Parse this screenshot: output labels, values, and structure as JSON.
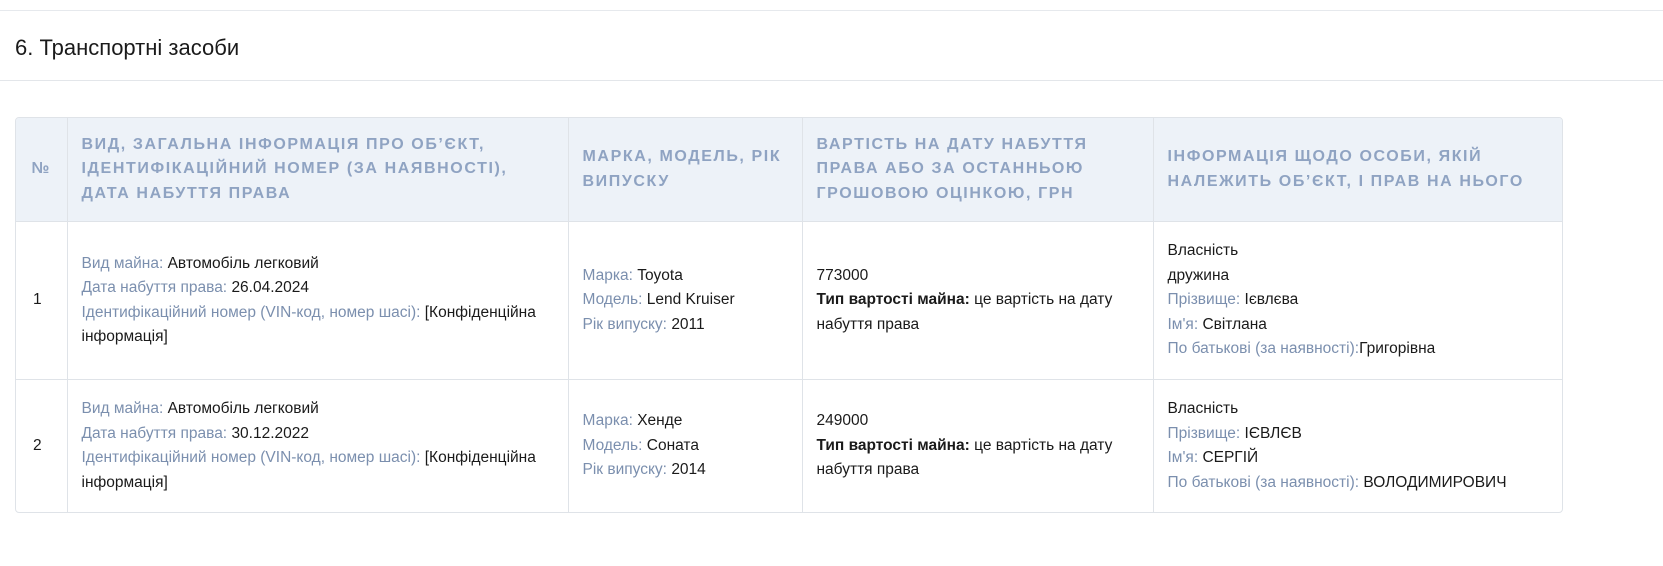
{
  "section": {
    "title": "6. Транспортні засоби"
  },
  "table": {
    "headers": [
      "№",
      "Вид, загальна інформація про об’єкт, ідентифікаційний номер (за наявності), дата набуття права",
      "Марка, модель, рік випуску",
      "Вартість на дату набуття права або за останньою грошовою оцінкою, грн",
      "Інформація щодо особи, якій належить об’єкт, і прав на нього"
    ],
    "rows": [
      {
        "num": "1",
        "type_label": "Вид майна:",
        "type_value": "Автомобіль легковий",
        "date_label": "Дата набуття права:",
        "date_value": "26.04.2024",
        "vin_label": "Ідентифікаційний номер (VIN-код, номер шасі):",
        "vin_value": "[Конфіденційна інформація]",
        "brand_label": "Марка:",
        "brand_value": "Toyota",
        "model_label": "Модель:",
        "model_value": "Lend Kruiser",
        "year_label": "Рік випуску:",
        "year_value": "2011",
        "cost_value": "773000",
        "cost_type_label": "Тип вартості майна:",
        "cost_type_value": "це вартість на дату набуття права",
        "owner_right": "Власність",
        "owner_relation": "дружина",
        "surname_label": "Прізвище:",
        "surname_value": "Ієвлєва",
        "name_label": "Ім'я:",
        "name_value": "Світлана",
        "patronymic_label": "По батькові (за наявності):",
        "patronymic_value": "Григорівна"
      },
      {
        "num": "2",
        "type_label": "Вид майна:",
        "type_value": "Автомобіль легковий",
        "date_label": "Дата набуття права:",
        "date_value": "30.12.2022",
        "vin_label": "Ідентифікаційний номер (VIN-код, номер шасі):",
        "vin_value": "[Конфіденційна інформація]",
        "brand_label": "Марка:",
        "brand_value": "Хенде",
        "model_label": "Модель:",
        "model_value": "Соната",
        "year_label": "Рік випуску:",
        "year_value": "2014",
        "cost_value": "249000",
        "cost_type_label": "Тип вартості майна:",
        "cost_type_value": "це вартість на дату набуття права",
        "owner_right": "Власність",
        "surname_label": "Прізвище:",
        "surname_value": "ІЄВЛЄВ",
        "name_label": "Ім'я:",
        "name_value": "СЕРГІЙ",
        "patronymic_label": "По батькові (за наявності):",
        "patronymic_value": "ВОЛОДИМИРОВИЧ"
      }
    ]
  },
  "colors": {
    "header_bg": "#edf2f8",
    "header_text": "#8fa3c2",
    "label_text": "#7b8fae",
    "border": "#dfe3e8"
  }
}
